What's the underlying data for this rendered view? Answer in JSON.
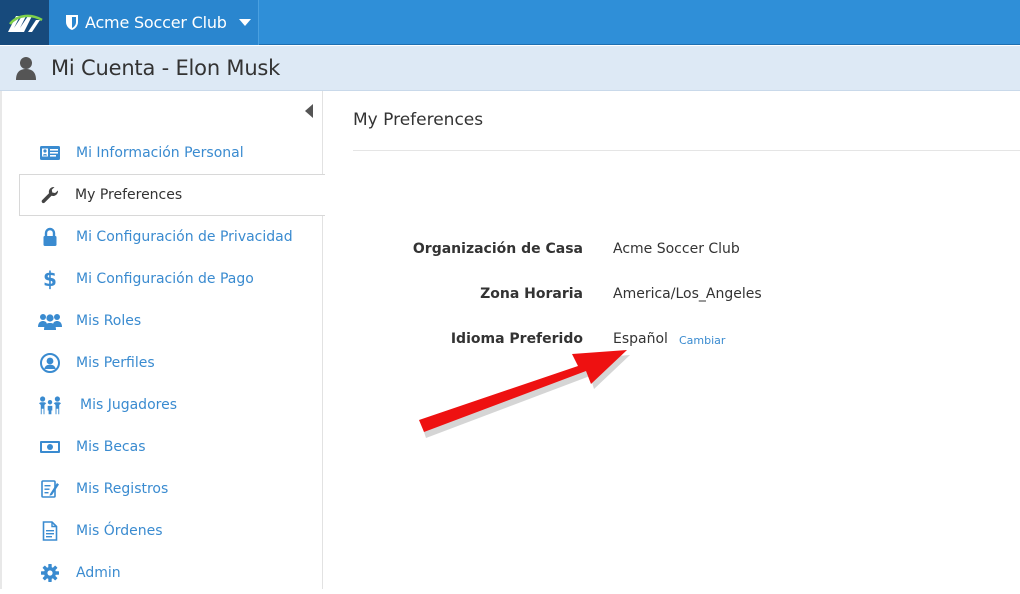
{
  "topbar": {
    "logo_icon": "club-logo-icon",
    "org_name": "Acme Soccer Club",
    "colors": {
      "bar": "#2f8fd8",
      "logo_bg": "#174a7c"
    }
  },
  "header": {
    "title": "Mi Cuenta - Elon Musk",
    "background": "#dde9f5"
  },
  "sidebar": {
    "items": [
      {
        "label": "Mi Información Personal",
        "icon": "id-card-icon",
        "active": false
      },
      {
        "label": "My Preferences",
        "icon": "wrench-icon",
        "active": true
      },
      {
        "label": "Mi Configuración de Privacidad",
        "icon": "lock-icon",
        "active": false
      },
      {
        "label": "Mi Configuración de Pago",
        "icon": "dollar-icon",
        "active": false
      },
      {
        "label": "Mis Roles",
        "icon": "users-icon",
        "active": false
      },
      {
        "label": "Mis Perfiles",
        "icon": "user-circle-icon",
        "active": false
      },
      {
        "label": "Mis Jugadores",
        "icon": "children-icon",
        "active": false
      },
      {
        "label": "Mis Becas",
        "icon": "money-icon",
        "active": false
      },
      {
        "label": "Mis Registros",
        "icon": "edit-document-icon",
        "active": false
      },
      {
        "label": "Mis Órdenes",
        "icon": "document-icon",
        "active": false
      },
      {
        "label": "Admin",
        "icon": "gear-icon",
        "active": false
      }
    ],
    "link_color": "#3a8bd0"
  },
  "main": {
    "title": "My Preferences",
    "rows": [
      {
        "label": "Organización de Casa",
        "value": "Acme Soccer Club"
      },
      {
        "label": "Zona Horaria",
        "value": "America/Los_Angeles"
      },
      {
        "label": "Idioma Preferido",
        "value": "Español",
        "link": "Cambiar"
      }
    ],
    "annotation_color": "#ee1111"
  }
}
